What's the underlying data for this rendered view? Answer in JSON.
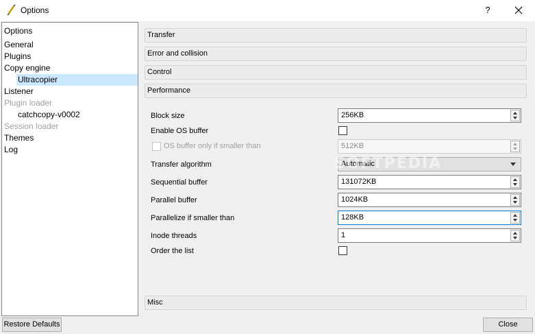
{
  "window": {
    "title": "Options",
    "help": "?"
  },
  "tree": {
    "items": [
      {
        "label": "Options"
      },
      {
        "label": "General"
      },
      {
        "label": "Plugins"
      },
      {
        "label": "Copy engine"
      },
      {
        "label": "Ultracopier"
      },
      {
        "label": "Listener"
      },
      {
        "label": "Plugin loader"
      },
      {
        "label": "catchcopy-v0002"
      },
      {
        "label": "Session loader"
      },
      {
        "label": "Themes"
      },
      {
        "label": "Log"
      }
    ]
  },
  "sections": {
    "transfer": "Transfer",
    "error": "Error and collision",
    "control": "Control",
    "performance": "Performance",
    "misc": "Misc"
  },
  "performance": {
    "block_size": {
      "label": "Block size",
      "value": "256KB"
    },
    "enable_os_buffer": {
      "label": "Enable OS buffer",
      "checked": false
    },
    "os_buffer_smaller": {
      "label": "OS buffer only if smaller than",
      "value": "512KB",
      "checked": false
    },
    "transfer_algorithm": {
      "label": "Transfer algorithm",
      "value": "Automatic"
    },
    "sequential_buffer": {
      "label": "Sequential buffer",
      "value": "131072KB"
    },
    "parallel_buffer": {
      "label": "Parallel buffer",
      "value": "1024KB"
    },
    "parallelize_smaller": {
      "label": "Parallelize if smaller than",
      "value": "128KB"
    },
    "inode_threads": {
      "label": "Inode threads",
      "value": "1"
    },
    "order_list": {
      "label": "Order the list",
      "checked": false
    }
  },
  "watermark": "SOFTPEDIA",
  "buttons": {
    "restore": "Restore Defaults",
    "close": "Close"
  }
}
